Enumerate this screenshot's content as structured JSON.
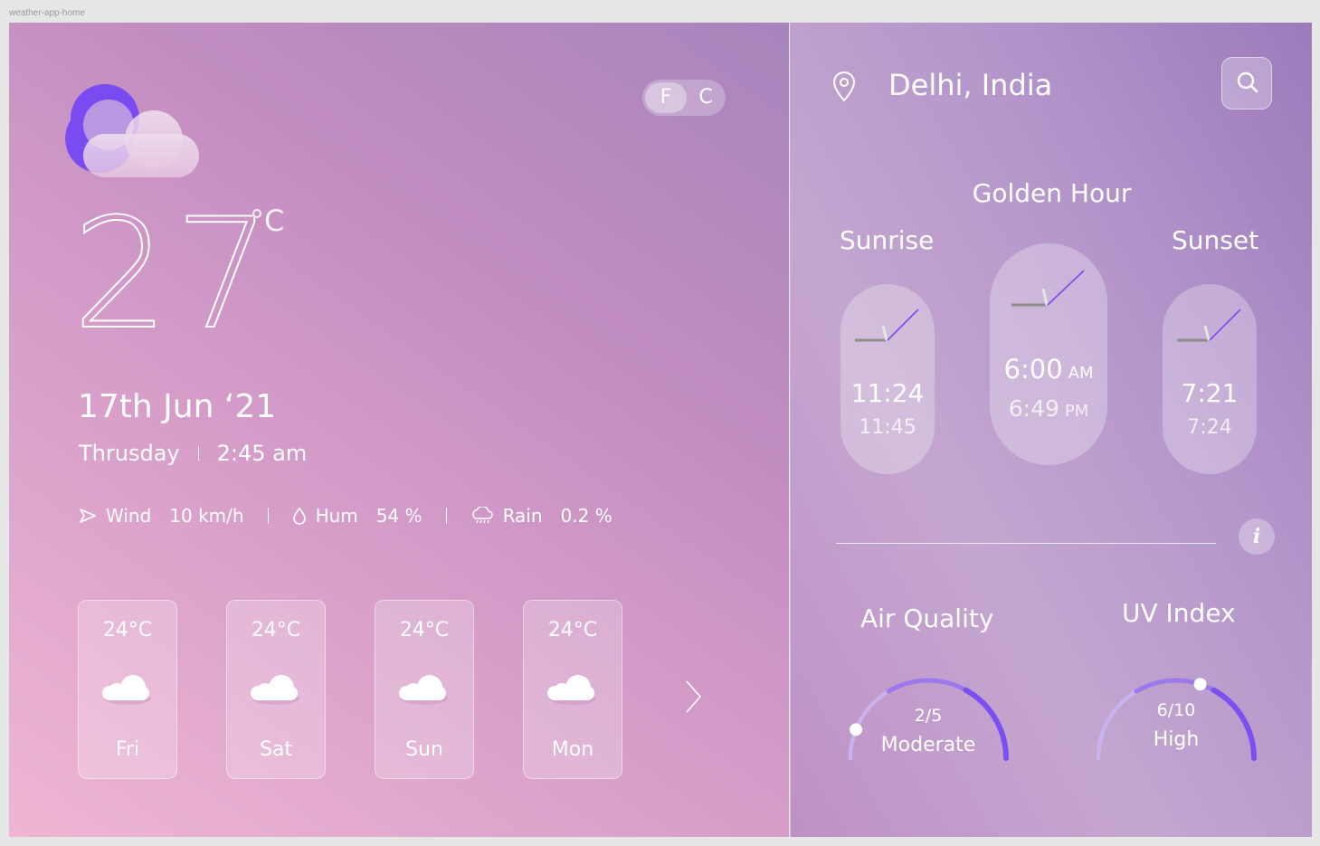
{
  "frame": {
    "label": "weather-app-home"
  },
  "units": {
    "fahrenheit": "F",
    "celsius": "C"
  },
  "current": {
    "temperature": "27",
    "unit": "°C",
    "date": "17th Jun ‘21",
    "weekday": "Thrusday",
    "time": "2:45 am",
    "condition_icon": "moon-cloud-icon"
  },
  "stats": {
    "wind": {
      "label": "Wind",
      "value": "10 km/h",
      "icon": "wind-arrow-icon"
    },
    "humidity": {
      "label": "Hum",
      "value": "54 %",
      "icon": "droplet-icon"
    },
    "rain": {
      "label": "Rain",
      "value": "0.2 %",
      "icon": "rain-cloud-icon"
    }
  },
  "forecast": [
    {
      "temp": "24°C",
      "day": "Fri"
    },
    {
      "temp": "24°C",
      "day": "Sat"
    },
    {
      "temp": "24°C",
      "day": "Sun"
    },
    {
      "temp": "24°C",
      "day": "Mon"
    }
  ],
  "location": {
    "name": "Delhi, India"
  },
  "golden_hour": {
    "title": "Golden Hour",
    "sunrise_label": "Sunrise",
    "sunset_label": "Sunset",
    "sunrise": {
      "time_main": "11:24",
      "time_sub": "11:45"
    },
    "center": {
      "time_main": "6:00",
      "main_suffix": "AM",
      "time_sub": "6:49",
      "sub_suffix": "PM"
    },
    "sunset": {
      "time_main": "7:21",
      "time_sub": "7:24"
    }
  },
  "air_quality": {
    "title": "Air Quality",
    "score": "2/5",
    "level": "Moderate",
    "fraction": 0.12
  },
  "uv_index": {
    "title": "UV Index",
    "score": "6/10",
    "level": "High",
    "fraction": 0.6
  },
  "colors": {
    "accent": "#7b4ff0",
    "gauge_light": "#c9b2f2"
  }
}
